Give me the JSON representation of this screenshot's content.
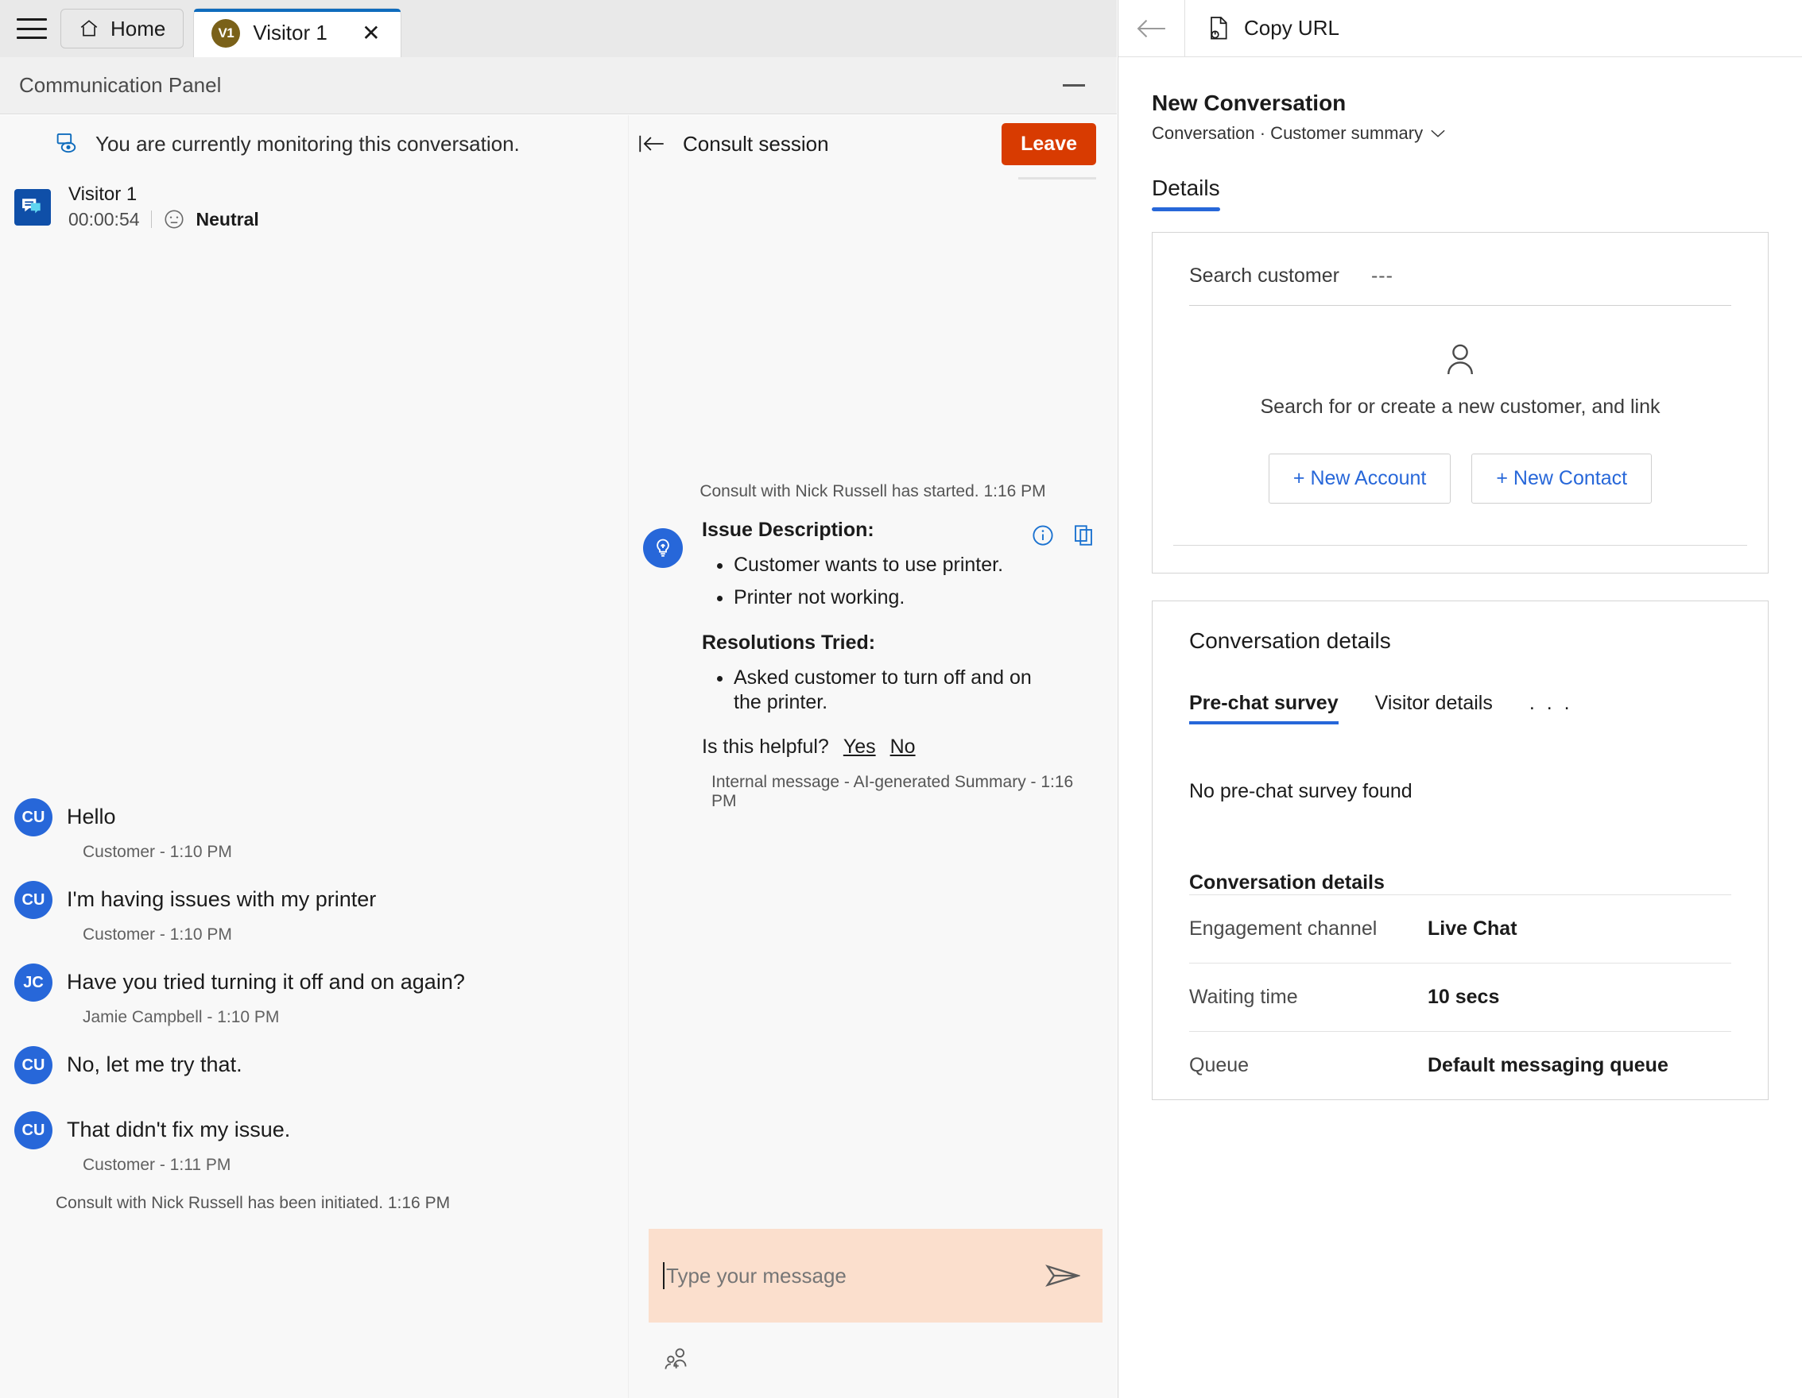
{
  "tabstrip": {
    "menu_icon": "hamburger-icon",
    "home_label": "Home",
    "visitor_tab": {
      "avatar_initials": "V1",
      "title": "Visitor 1",
      "close_label": "✕"
    }
  },
  "comm_panel": {
    "title": "Communication Panel",
    "minimize_label": "Minimize"
  },
  "conversation": {
    "monitor_notice": "You are currently monitoring this conversation.",
    "visitor": {
      "name": "Visitor 1",
      "duration": "00:00:54",
      "sentiment": "Neutral"
    },
    "messages": [
      {
        "initials": "CU",
        "text": "Hello",
        "meta": "Customer - 1:10 PM"
      },
      {
        "initials": "CU",
        "text": "I'm having issues with my printer",
        "meta": "Customer - 1:10 PM"
      },
      {
        "initials": "JC",
        "text": "Have you tried turning it off and on again?",
        "meta": "Jamie Campbell - 1:10 PM"
      },
      {
        "initials": "CU",
        "text": "No, let me try that.",
        "meta": ""
      },
      {
        "initials": "CU",
        "text": "That didn't fix my issue.",
        "meta": "Customer - 1:11 PM"
      }
    ],
    "system_line": "Consult with Nick Russell has been initiated. 1:16 PM"
  },
  "consult": {
    "header_title": "Consult session",
    "leave_label": "Leave",
    "started_notice": "Consult with Nick Russell has started. 1:16 PM",
    "summary": {
      "issue_heading": "Issue Description:",
      "issue_items": [
        "Customer wants to use printer.",
        "Printer not working."
      ],
      "resolutions_heading": "Resolutions Tried:",
      "resolution_items": [
        "Asked customer to turn off and on the printer."
      ],
      "helpful_question": "Is this helpful?",
      "helpful_yes": "Yes",
      "helpful_no": "No",
      "footer": "Internal message - AI-generated Summary - 1:16 PM"
    },
    "composer": {
      "placeholder": "Type your message",
      "value": ""
    }
  },
  "right_panel": {
    "toolbar": {
      "back_label": "Back",
      "copy_url_label": "Copy URL"
    },
    "title": "New Conversation",
    "breadcrumb": "Conversation · Customer summary",
    "tabs": [
      {
        "label": "Details",
        "active": true
      }
    ],
    "customer_card": {
      "search_label": "Search customer",
      "search_value": "---",
      "empty_message": "Search for or create a new customer, and link",
      "new_account_label": "+ New Account",
      "new_contact_label": "+ New Contact"
    },
    "conversation_details": {
      "title": "Conversation details",
      "tabs": [
        {
          "label": "Pre-chat survey",
          "active": true
        },
        {
          "label": "Visitor details",
          "active": false
        }
      ],
      "more_label": ". . .",
      "empty_text": "No pre-chat survey found",
      "section_title": "Conversation details",
      "rows": [
        {
          "key": "Engagement channel",
          "value": "Live Chat"
        },
        {
          "key": "Waiting time",
          "value": "10 secs"
        },
        {
          "key": "Queue",
          "value": "Default messaging queue"
        }
      ]
    }
  },
  "colors": {
    "accent_blue": "#2767d9",
    "tab_accent": "#0f6cbd",
    "leave_red": "#d83b01",
    "composer_bg": "#fbdfcd",
    "avatar_blue": "#2767d9",
    "visitor_badge_blue": "#0f4fa8",
    "tab_avatar_gold": "#7a6119"
  }
}
